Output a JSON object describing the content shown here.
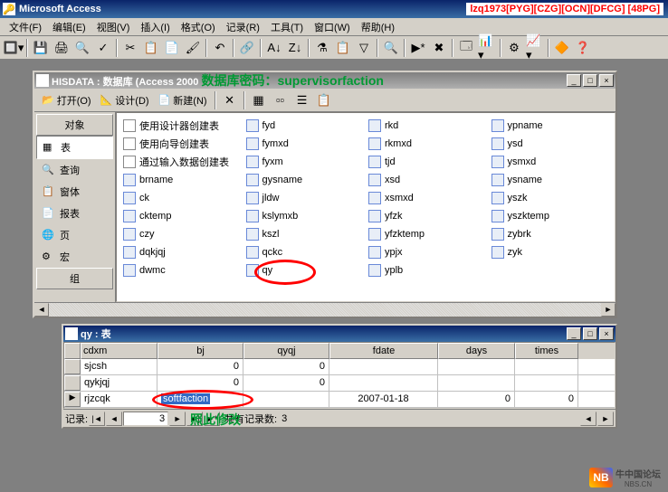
{
  "app": {
    "title": "Microsoft Access",
    "badge": "lzq1973[PYG][CZG][OCN][DFCG] [48PG]"
  },
  "menu": {
    "file": "文件(F)",
    "edit": "编辑(E)",
    "view": "视图(V)",
    "insert": "插入(I)",
    "format": "格式(O)",
    "records": "记录(R)",
    "tools": "工具(T)",
    "window": "窗口(W)",
    "help": "帮助(H)"
  },
  "db_window": {
    "title": "HISDATA : 数据库 (Access 2000",
    "overlay": "数据库密码：supervisorfaction",
    "toolbar": {
      "open": "打开(O)",
      "design": "设计(D)",
      "new": "新建(N)"
    },
    "sidebar": {
      "header": "对象",
      "items": [
        "表",
        "查询",
        "窗体",
        "报表",
        "页",
        "宏"
      ],
      "footer": "组"
    },
    "tables": {
      "wizards": [
        "使用设计器创建表",
        "使用向导创建表",
        "通过输入数据创建表"
      ],
      "col1": [
        "brname",
        "ck",
        "cktemp",
        "czy",
        "dqkjqj",
        "dwmc"
      ],
      "col2": [
        "fyd",
        "fymxd",
        "fyxm",
        "gysname",
        "jldw",
        "kslymxb",
        "kszl",
        "qckc",
        "qy"
      ],
      "col3": [
        "rkd",
        "rkmxd",
        "tjd",
        "xsd",
        "xsmxd",
        "yfzk",
        "yfzktemp",
        "ypjx",
        "yplb"
      ],
      "col4": [
        "ypname",
        "ysd",
        "ysmxd",
        "ysname",
        "yszk",
        "yszktemp",
        "zybrk",
        "zyk"
      ]
    }
  },
  "ds_window": {
    "title": "qy : 表",
    "columns": [
      "cdxm",
      "bj",
      "qyqj",
      "fdate",
      "days",
      "times"
    ],
    "rows": [
      {
        "sel": "",
        "cdxm": "sjcsh",
        "bj": "0",
        "qyqj": "0",
        "fdate": "",
        "days": "",
        "times": ""
      },
      {
        "sel": "",
        "cdxm": "qykjqj",
        "bj": "0",
        "qyqj": "0",
        "fdate": "",
        "days": "",
        "times": ""
      },
      {
        "sel": "▶",
        "cdxm": "rjzcqk",
        "bj": "softfaction",
        "qyqj": "",
        "fdate": "2007-01-18",
        "days": "0",
        "times": "0"
      }
    ],
    "nav": {
      "label": "记录:",
      "current": "3",
      "total_label": "共有记录数:",
      "total": "3"
    },
    "overlay": "照此修改"
  },
  "watermark": {
    "logo": "NB",
    "text": "牛中国论坛",
    "sub": "NBS.CN"
  }
}
